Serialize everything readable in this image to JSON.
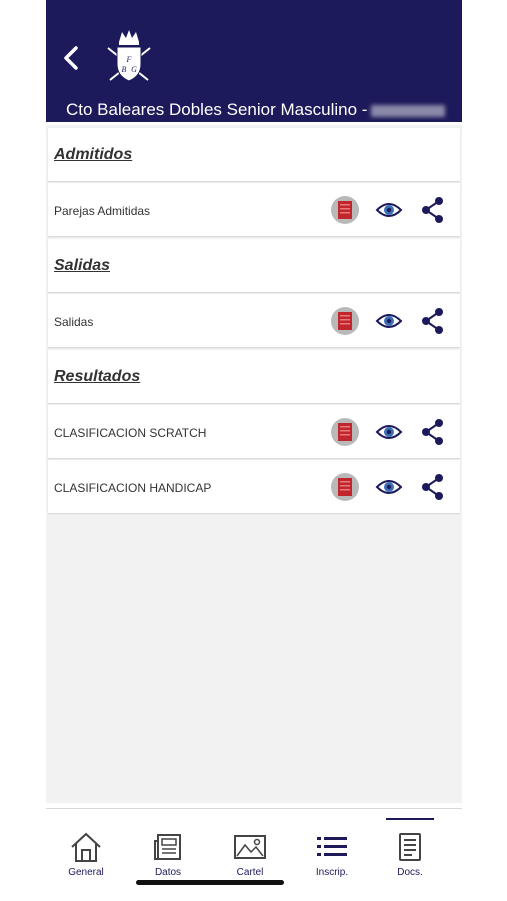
{
  "header": {
    "title": "Cto Baleares Dobles Senior Masculino -",
    "logo_text": "FBG",
    "bg_color": "#1c1a5a"
  },
  "sections": [
    {
      "title": "Admitidos",
      "documents": [
        {
          "label": "Parejas Admitidas"
        }
      ]
    },
    {
      "title": "Salidas",
      "documents": [
        {
          "label": "Salidas"
        }
      ]
    },
    {
      "title": "Resultados",
      "documents": [
        {
          "label": "CLASIFICACION SCRATCH"
        },
        {
          "label": "CLASIFICACION HANDICAP"
        }
      ]
    }
  ],
  "doc_icons": [
    "pdf-icon",
    "eye-icon",
    "share-icon"
  ],
  "tabbar": {
    "tabs": [
      {
        "label": "General",
        "icon": "home-icon"
      },
      {
        "label": "Datos",
        "icon": "newspaper-icon"
      },
      {
        "label": "Cartel",
        "icon": "image-icon"
      },
      {
        "label": "Inscrip.",
        "icon": "list-icon"
      },
      {
        "label": "Docs.",
        "icon": "document-icon",
        "selected": true
      }
    ]
  },
  "colors": {
    "accent": "#1c1a5a",
    "pdf_red": "#c0262b"
  }
}
